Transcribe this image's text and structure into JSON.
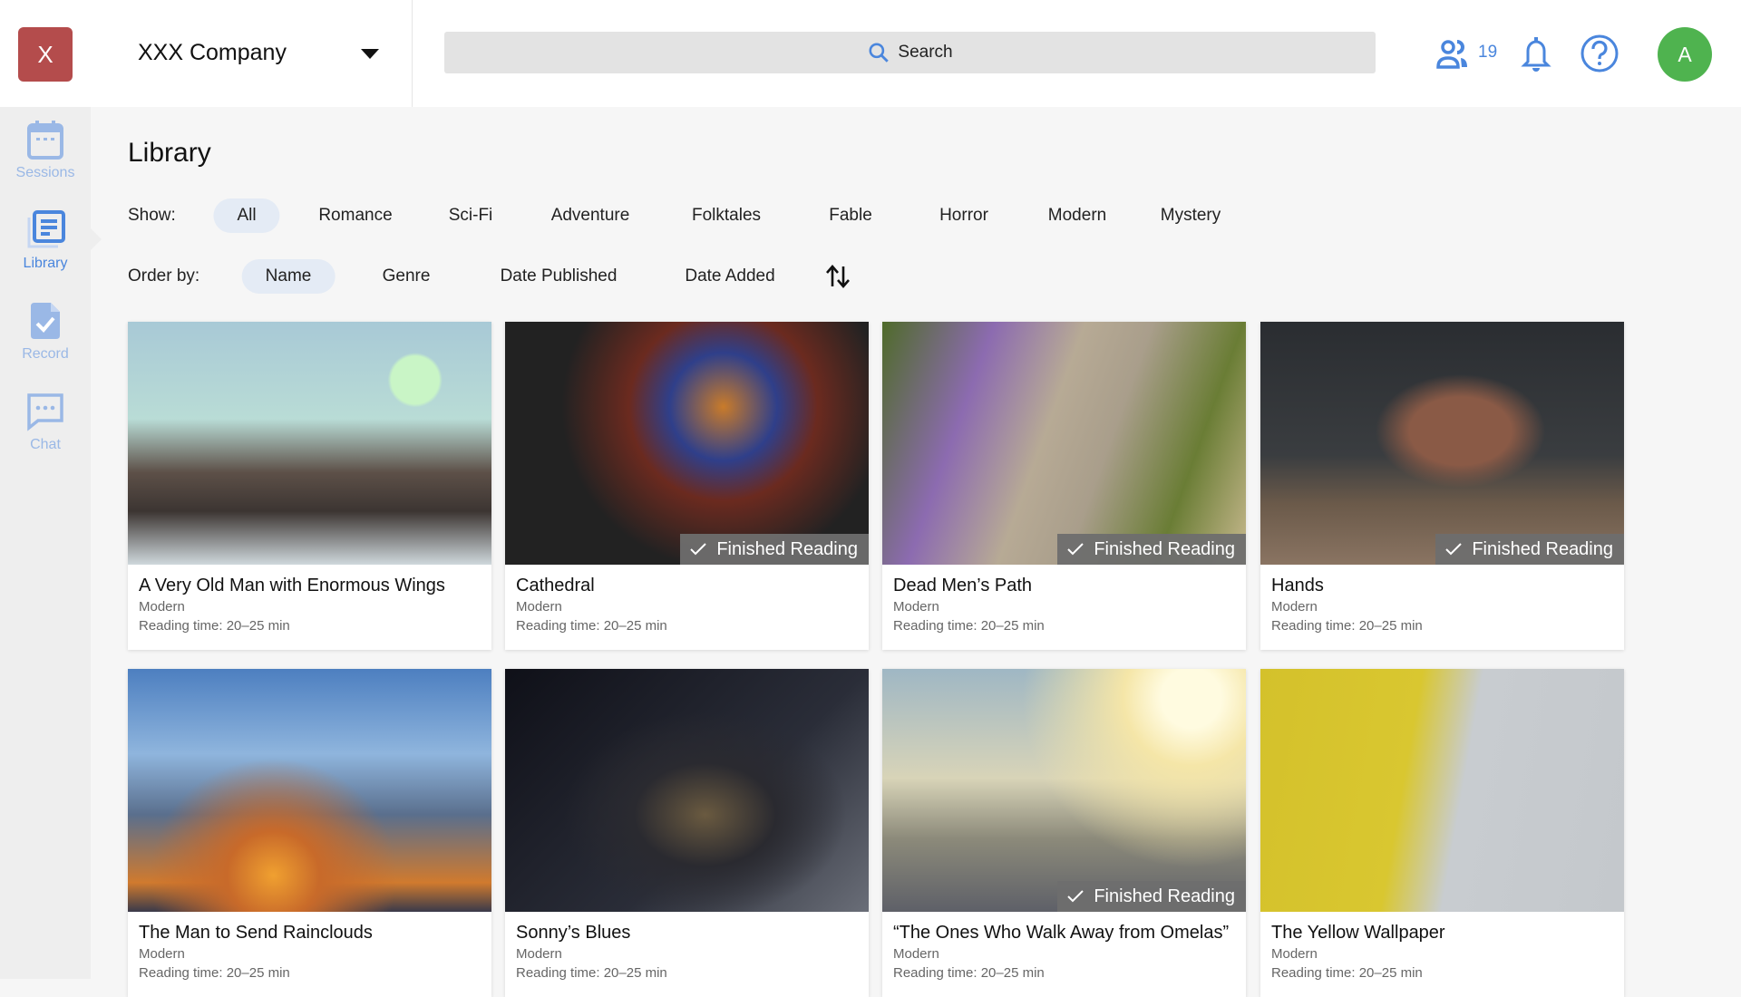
{
  "header": {
    "logo_letter": "X",
    "company": "XXX Company",
    "search_placeholder": "Search",
    "user_count": "19",
    "avatar_letter": "A"
  },
  "sidebar": {
    "items": [
      {
        "label": "Sessions",
        "icon": "calendar-icon"
      },
      {
        "label": "Library",
        "icon": "library-icon",
        "active": true
      },
      {
        "label": "Record",
        "icon": "document-check-icon"
      },
      {
        "label": "Chat",
        "icon": "chat-icon"
      }
    ]
  },
  "page": {
    "title": "Library",
    "show_label": "Show:",
    "order_label": "Order by:",
    "filters": [
      "All",
      "Romance",
      "Sci-Fi",
      "Adventure",
      "Folktales",
      "Fable",
      "Horror",
      "Modern",
      "Mystery"
    ],
    "selected_filter": "All",
    "orders": [
      "Name",
      "Genre",
      "Date Published",
      "Date Added"
    ],
    "selected_order": "Name"
  },
  "badge_label": "Finished Reading",
  "books": [
    {
      "title": "A Very Old Man with Enormous Wings",
      "genre": "Modern",
      "time": "Reading time: 20–25 min",
      "finished": false
    },
    {
      "title": "Cathedral",
      "genre": "Modern",
      "time": "Reading time: 20–25 min",
      "finished": true
    },
    {
      "title": "Dead Men’s Path",
      "genre": "Modern",
      "time": "Reading time: 20–25 min",
      "finished": true
    },
    {
      "title": "Hands",
      "genre": "Modern",
      "time": "Reading time: 20–25 min",
      "finished": true
    },
    {
      "title": "The Man to Send Rainclouds",
      "genre": "Modern",
      "time": "Reading time: 20–25 min",
      "finished": false
    },
    {
      "title": "Sonny’s Blues",
      "genre": "Modern",
      "time": "Reading time: 20–25 min",
      "finished": false
    },
    {
      "title": "“The Ones Who Walk Away from Omelas”",
      "genre": "Modern",
      "time": "Reading time: 20–25 min",
      "finished": true
    },
    {
      "title": "The Yellow Wallpaper",
      "genre": "Modern",
      "time": "Reading time: 20–25 min",
      "finished": false
    }
  ],
  "colors": {
    "accent": "#4a86dd",
    "logo": "#b44c4c",
    "avatar": "#4fb34f",
    "chip_selected": "#e4ebf5"
  }
}
